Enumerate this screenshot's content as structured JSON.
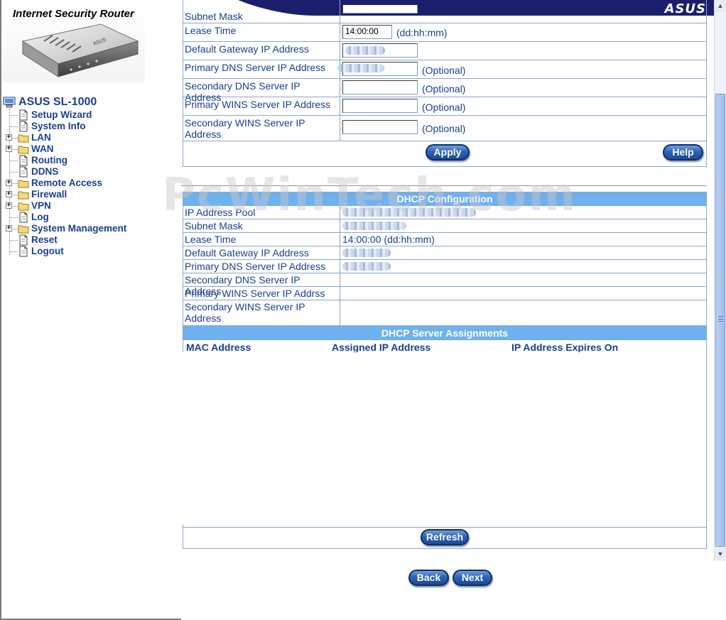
{
  "header": {
    "product_title": "Internet Security Router",
    "brand": "ASUS"
  },
  "nav": {
    "root_label": "ASUS SL-1000",
    "items": [
      {
        "label": "Setup Wizard",
        "expandable": false,
        "icon": "document-icon"
      },
      {
        "label": "System Info",
        "expandable": false,
        "icon": "document-icon"
      },
      {
        "label": "LAN",
        "expandable": true,
        "icon": "folder-icon"
      },
      {
        "label": "WAN",
        "expandable": true,
        "icon": "folder-icon"
      },
      {
        "label": "Routing",
        "expandable": false,
        "icon": "document-icon"
      },
      {
        "label": "DDNS",
        "expandable": false,
        "icon": "document-icon"
      },
      {
        "label": "Remote Access",
        "expandable": true,
        "icon": "folder-icon"
      },
      {
        "label": "Firewall",
        "expandable": true,
        "icon": "folder-icon"
      },
      {
        "label": "VPN",
        "expandable": true,
        "icon": "folder-icon"
      },
      {
        "label": "Log",
        "expandable": false,
        "icon": "document-icon"
      },
      {
        "label": "System Management",
        "expandable": true,
        "icon": "folder-icon"
      },
      {
        "label": "Reset",
        "expandable": false,
        "icon": "document-icon"
      },
      {
        "label": "Logout",
        "expandable": false,
        "icon": "document-icon"
      }
    ]
  },
  "dhcp_form": {
    "subnet_mask_label": "Subnet Mask",
    "lease_time_label": "Lease Time",
    "lease_time_value": "14:00:00",
    "lease_time_hint": "(dd:hh:mm)",
    "gateway_label": "Default Gateway IP Address",
    "primary_dns_label": "Primary DNS Server IP Address",
    "secondary_dns_label": "Secondary DNS Server IP Address",
    "primary_wins_label": "Primary WINS Server IP Address",
    "secondary_wins_label": "Secondary WINS Server IP Address",
    "optional_hint": "(Optional)",
    "apply_label": "Apply",
    "help_label": "Help"
  },
  "dhcp_config": {
    "title": "DHCP Configuration",
    "ip_pool_label": "IP Address Pool",
    "subnet_mask_label": "Subnet Mask",
    "lease_time_label": "Lease Time",
    "lease_time_value": "14:00:00 (dd:hh:mm)",
    "gateway_label": "Default Gateway IP Address",
    "primary_dns_label": "Primary DNS Server IP Address",
    "secondary_dns_label": "Secondary DNS Server IP Address",
    "primary_wins_label": "Primary WINS Server IP Addrss",
    "secondary_wins_label": "Secondary WINS Server IP Address"
  },
  "assignments": {
    "title": "DHCP Server Assignments",
    "col_mac": "MAC Address",
    "col_ip": "Assigned IP Address",
    "col_expires": "IP Address Expires On",
    "refresh_label": "Refresh"
  },
  "footer": {
    "back_label": "Back",
    "next_label": "Next"
  },
  "watermark": "PcWinTech.com",
  "colors": {
    "accent": "#1a3f8f",
    "section_header": "#6fb0ee",
    "button": "#2d62b8"
  }
}
